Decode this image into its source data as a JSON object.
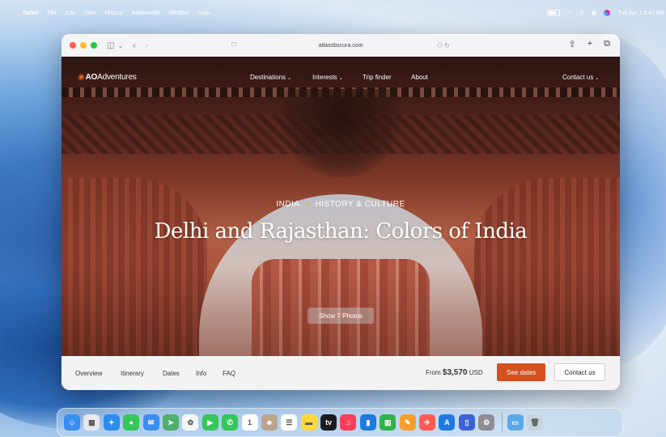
{
  "menubar": {
    "app_name": "Safari",
    "items": [
      "File",
      "Edit",
      "View",
      "History",
      "Bookmarks",
      "Window",
      "Help"
    ],
    "datetime": "Tue Apr 1  9:41 AM"
  },
  "browser": {
    "url": "atlasobscura.com"
  },
  "site": {
    "logo_bold": "AO",
    "logo_rest": "Adventures",
    "nav": {
      "destinations": "Destinations",
      "interests": "Interests",
      "trip_finder": "Trip finder",
      "about": "About",
      "contact": "Contact us"
    }
  },
  "hero": {
    "eyebrow_country": "INDIA",
    "eyebrow_category": "HISTORY & CULTURE",
    "title": "Delhi and Rajasthan: Colors of India",
    "photos_button": "Show 7 Photos"
  },
  "booking": {
    "tabs": [
      "Overview",
      "Itinerary",
      "Dates",
      "Info",
      "FAQ"
    ],
    "price_prefix": "From",
    "price_amount": "$3,570",
    "price_currency": "USD",
    "see_dates": "See dates",
    "contact": "Contact us"
  },
  "dock": {
    "apps": [
      {
        "icon": "finder-icon",
        "color": "#3a8ef0",
        "glyph": "☺"
      },
      {
        "icon": "launchpad-icon",
        "color": "#e8e8ee",
        "glyph": "▦"
      },
      {
        "icon": "safari-icon",
        "color": "#2d8cf0",
        "glyph": "✦"
      },
      {
        "icon": "messages-icon",
        "color": "#34c759",
        "glyph": "●"
      },
      {
        "icon": "mail-icon",
        "color": "#3b8df0",
        "glyph": "✉"
      },
      {
        "icon": "maps-icon",
        "color": "#4fb06a",
        "glyph": "➤"
      },
      {
        "icon": "photos-icon",
        "color": "#f5f5f5",
        "glyph": "✿"
      },
      {
        "icon": "facetime-icon",
        "color": "#34c759",
        "glyph": "▶"
      },
      {
        "icon": "phone-icon",
        "color": "#34c759",
        "glyph": "✆"
      },
      {
        "icon": "calendar-icon",
        "color": "#ffffff",
        "glyph": "1"
      },
      {
        "icon": "contacts-icon",
        "color": "#bba58a",
        "glyph": "☻"
      },
      {
        "icon": "reminders-icon",
        "color": "#ffffff",
        "glyph": "☰"
      },
      {
        "icon": "notes-icon",
        "color": "#ffd93b",
        "glyph": "▬"
      },
      {
        "icon": "tv-icon",
        "color": "#1c1c1e",
        "glyph": "tv"
      },
      {
        "icon": "music-icon",
        "color": "#fa3d5a",
        "glyph": "♫"
      },
      {
        "icon": "keynote-icon",
        "color": "#1f7ae0",
        "glyph": "▮"
      },
      {
        "icon": "numbers-icon",
        "color": "#2fb34a",
        "glyph": "▥"
      },
      {
        "icon": "pages-icon",
        "color": "#f79d2a",
        "glyph": "✎"
      },
      {
        "icon": "testflight-icon",
        "color": "#ff5a52",
        "glyph": "✈"
      },
      {
        "icon": "app-store-icon",
        "color": "#1f7ae0",
        "glyph": "A"
      },
      {
        "icon": "iphone-mirroring-icon",
        "color": "#3d62d8",
        "glyph": "▯"
      },
      {
        "icon": "system-settings-icon",
        "color": "#8e8e93",
        "glyph": "⚙"
      }
    ],
    "trailing": [
      {
        "icon": "downloads-folder-icon",
        "color": "#5aa8e8",
        "glyph": "▭"
      },
      {
        "icon": "trash-icon",
        "color": "#c9d3dc",
        "glyph": "🗑"
      }
    ]
  }
}
